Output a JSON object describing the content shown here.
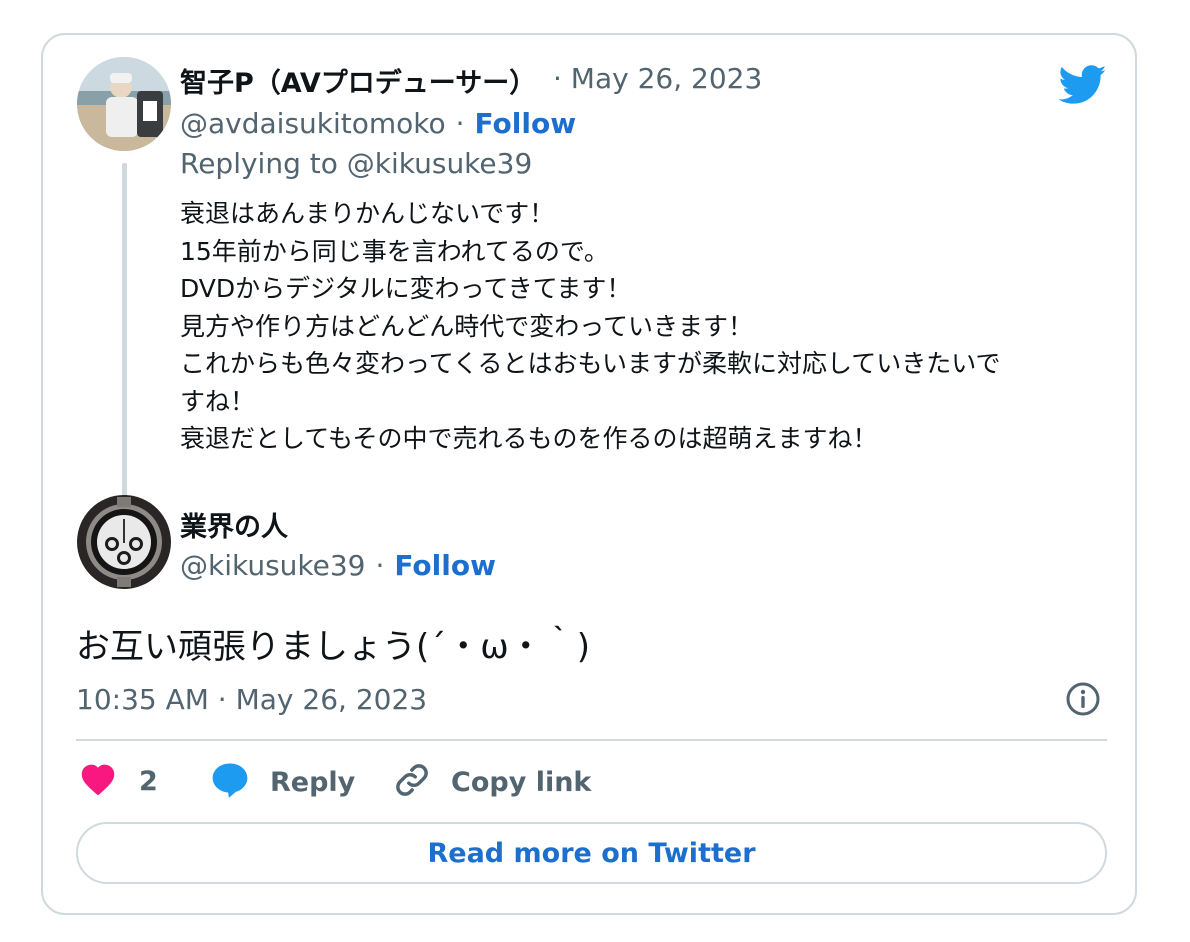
{
  "reply_tweet": {
    "display_name": "智子P（AVプロデューサー）",
    "date": "· May 26, 2023",
    "handle": "@avdaisukitomoko",
    "separator": "·",
    "follow_label": "Follow",
    "replying_to": "Replying to @kikusuke39",
    "lines": [
      "衰退はあんまりかんじないです！",
      "15年前から同じ事を言われてるので。",
      "DVDからデジタルに変わってきてます！",
      "見方や作り方はどんどん時代で変わっていきます！",
      "これからも色々変わってくるとはおもいますが柔軟に対応していきたいで",
      "すね！",
      "衰退だとしてもその中で売れるものを作るのは超萌えますね！"
    ]
  },
  "main_tweet": {
    "display_name": "業界の人",
    "handle": "@kikusuke39",
    "separator": "·",
    "follow_label": "Follow",
    "text": "お互い頑張りましょう(´・ω・｀)",
    "timestamp": "10:35 AM · May 26, 2023"
  },
  "actions": {
    "like_count": "2",
    "reply_label": "Reply",
    "copy_link_label": "Copy link"
  },
  "read_more_label": "Read more on Twitter",
  "icons": {
    "brand": "twitter-bird-icon",
    "like": "heart-icon",
    "reply": "speech-bubble-icon",
    "copy_link": "link-icon",
    "info": "info-icon"
  },
  "colors": {
    "twitter_blue": "#1d9bf0",
    "link_blue": "#1d6fce",
    "heart_pink": "#f91880",
    "muted_text": "#536471",
    "border": "#cfd9de"
  }
}
